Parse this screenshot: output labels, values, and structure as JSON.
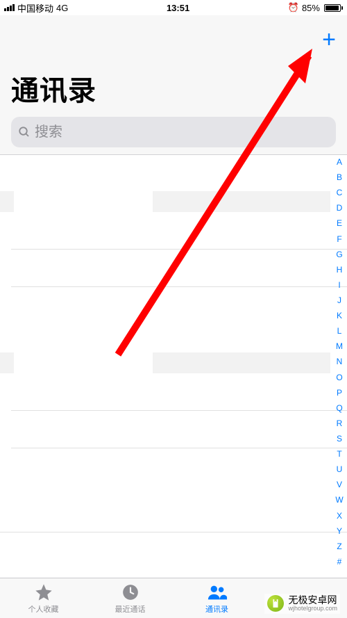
{
  "status_bar": {
    "carrier": "中国移动",
    "network": "4G",
    "time": "13:51",
    "battery_pct": "85%",
    "battery_fill_pct": 85
  },
  "header": {
    "title": "通讯录",
    "add_symbol": "+"
  },
  "search": {
    "placeholder": "搜索"
  },
  "alpha_index": [
    "A",
    "B",
    "C",
    "D",
    "E",
    "F",
    "G",
    "H",
    "I",
    "J",
    "K",
    "L",
    "M",
    "N",
    "O",
    "P",
    "Q",
    "R",
    "S",
    "T",
    "U",
    "V",
    "W",
    "X",
    "Y",
    "Z",
    "#"
  ],
  "tabs": {
    "favorites": "个人收藏",
    "recent": "最近通话",
    "contacts": "通讯录"
  },
  "watermark": {
    "name": "无极安卓网",
    "url": "wjhotelgroup.com"
  },
  "colors": {
    "accent": "#007aff",
    "arrow": "#ff0000"
  }
}
